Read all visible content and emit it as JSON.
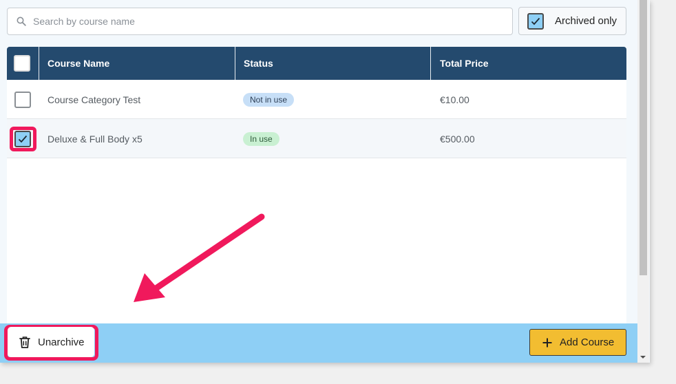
{
  "search": {
    "placeholder": "Search by course name",
    "value": "",
    "icon": "search-icon"
  },
  "filter": {
    "archived_only_label": "Archived only",
    "archived_only_checked": true
  },
  "table": {
    "columns": [
      "Course Name",
      "Status",
      "Total Price"
    ],
    "select_all_checked": false,
    "rows": [
      {
        "selected": false,
        "name": "Course Category Test",
        "status": "Not in use",
        "status_kind": "not-in-use",
        "price": "€10.00"
      },
      {
        "selected": true,
        "name": "Deluxe & Full Body x5",
        "status": "In use",
        "status_kind": "in-use",
        "price": "€500.00"
      }
    ]
  },
  "footer": {
    "unarchive_label": "Unarchive",
    "add_course_label": "Add Course"
  },
  "colors": {
    "header_bg": "#244a6e",
    "footer_bg": "#8ecff5",
    "accent_highlight": "#f0195c",
    "add_button_bg": "#f2bd31",
    "badge_not_in_use": "#c7dff7",
    "badge_in_use": "#c9f0d2"
  },
  "annotation": {
    "arrow_color": "#f0195c",
    "highlighted": [
      "selected-row-checkbox",
      "unarchive-button"
    ]
  }
}
